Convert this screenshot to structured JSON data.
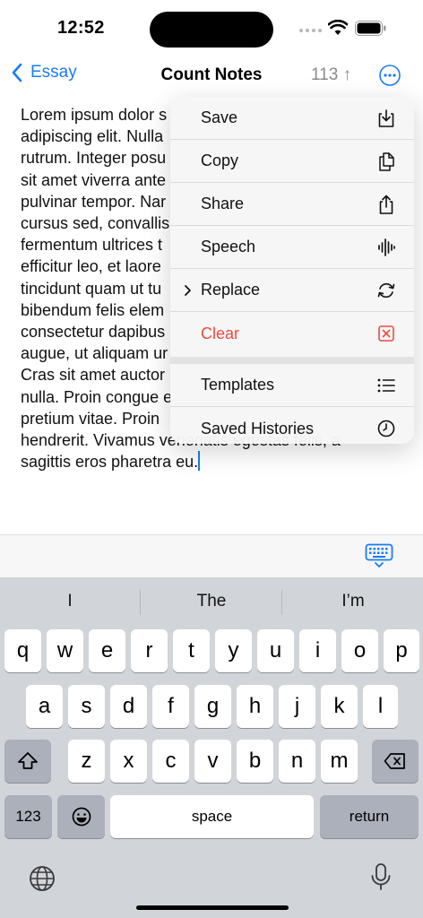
{
  "status": {
    "time": "12:52"
  },
  "nav": {
    "back_label": "Essay",
    "title": "Count Notes",
    "count": "113 ↑"
  },
  "editor": {
    "lines": [
      "Lorem ipsum dolor s",
      "adipiscing elit. Nulla",
      "rutrum. Integer posu",
      "sit amet viverra ante",
      "pulvinar tempor. Nar",
      "cursus sed, convallis",
      "fermentum ultrices t",
      "efficitur leo, et laore",
      "tincidunt quam ut tu",
      "bibendum felis elem",
      "consectetur dapibus",
      "augue, ut aliquam ur",
      "Cras sit amet auctor",
      "nulla. Proin congue e",
      "pretium vitae. Proin",
      "hendrerit. Vivamus venenatis egestas felis, a",
      "sagittis eros pharetra eu."
    ]
  },
  "menu": {
    "items": [
      {
        "label": "Save",
        "icon": "save-tray-icon"
      },
      {
        "label": "Copy",
        "icon": "copy-documents-icon"
      },
      {
        "label": "Share",
        "icon": "share-icon"
      },
      {
        "label": "Speech",
        "icon": "waveform-icon"
      },
      {
        "label": "Replace",
        "icon": "arrows-circle-icon"
      },
      {
        "label": "Clear",
        "icon": "clear-x-square-icon",
        "color": "#eb4a3f"
      },
      {
        "label": "Templates",
        "icon": "list-icon"
      },
      {
        "label": "Saved Histories",
        "icon": "clock-icon"
      }
    ]
  },
  "keyboard": {
    "suggestions": [
      "I",
      "The",
      "I’m"
    ],
    "row1": [
      "q",
      "w",
      "e",
      "r",
      "t",
      "y",
      "u",
      "i",
      "o",
      "p"
    ],
    "row2": [
      "a",
      "s",
      "d",
      "f",
      "g",
      "h",
      "j",
      "k",
      "l"
    ],
    "row3": [
      "z",
      "x",
      "c",
      "v",
      "b",
      "n",
      "m"
    ],
    "numbers_label": "123",
    "space_label": "space",
    "return_label": "return"
  },
  "colors": {
    "accent": "#1a7cf5",
    "destructive": "#eb4a3f"
  }
}
